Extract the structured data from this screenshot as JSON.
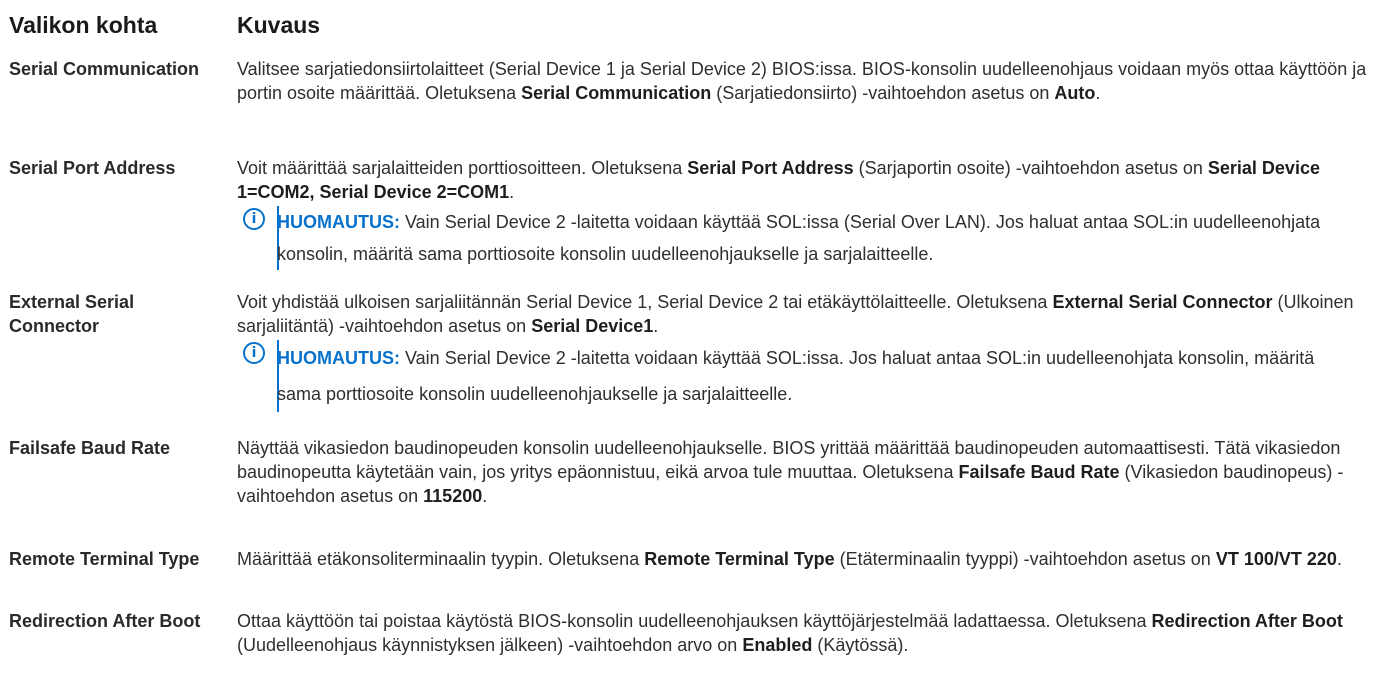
{
  "header": {
    "col1": "Valikon kohta",
    "col2": "Kuvaus"
  },
  "rows": [
    {
      "term": "Serial Communication",
      "desc": [
        "Valitsee sarjatiedonsiirtolaitteet (Serial Device 1 ja Serial Device 2) BIOS:issa. BIOS-konsolin uudelleenohjaus voidaan myös ottaa käyttöön ja portin osoite määrittää. Oletuksena ",
        "Serial Communication",
        " (Sarjatiedonsiirto) -vaihtoehdon asetus on ",
        "Auto",
        "."
      ]
    },
    {
      "term": "Serial Port Address",
      "desc": [
        "Voit määrittää sarjalaitteiden porttiosoitteen. Oletuksena ",
        "Serial Port Address",
        " (Sarjaportin osoite) -vaihtoehdon asetus on ",
        "Serial Device 1=COM2, Serial Device 2=COM1",
        "."
      ],
      "note": {
        "label": "HUOMAUTUS:",
        "text": " Vain Serial Device 2 -laitetta voidaan käyttää SOL:issa (Serial Over LAN). Jos haluat antaa SOL:in uudelleenohjata konsolin, määritä sama porttiosoite konsolin uudelleenohjaukselle ja sarjalaitteelle."
      }
    },
    {
      "term": "External Serial Connector",
      "desc": [
        "Voit yhdistää ulkoisen sarjaliitännän Serial Device 1, Serial Device 2 tai etäkäyttölaitteelle. Oletuksena ",
        "External Serial Connector",
        " (Ulkoinen sarjaliitäntä) -vaihtoehdon asetus on ",
        "Serial Device1",
        "."
      ],
      "note": {
        "label": "HUOMAUTUS:",
        "text": " Vain Serial Device 2 -laitetta voidaan käyttää SOL:issa. Jos haluat antaa SOL:in uudelleenohjata konsolin, määritä sama porttiosoite konsolin uudelleenohjaukselle ja sarjalaitteelle."
      }
    },
    {
      "term": "Failsafe Baud Rate",
      "desc": [
        "Näyttää vikasiedon baudinopeuden konsolin uudelleenohjaukselle. BIOS yrittää määrittää baudinopeuden automaattisesti. Tätä vikasiedon baudinopeutta käytetään vain, jos yritys epäonnistuu, eikä arvoa tule muuttaa. Oletuksena ",
        "Failsafe Baud Rate",
        " (Vikasiedon baudinopeus) -vaihtoehdon asetus on ",
        "115200",
        "."
      ]
    },
    {
      "term": "Remote Terminal Type",
      "desc": [
        "Määrittää etäkonsoliterminaalin tyypin. Oletuksena ",
        "Remote Terminal Type",
        " (Etäterminaalin tyyppi) -vaihtoehdon asetus on ",
        "VT 100/VT 220",
        "."
      ]
    },
    {
      "term": "Redirection After Boot",
      "desc": [
        "Ottaa käyttöön tai poistaa käytöstä BIOS-konsolin uudelleenohjauksen käyttöjärjestelmää ladattaessa. Oletuksena ",
        "Redirection After Boot",
        " (Uudelleenohjaus käynnistyksen jälkeen) -vaihtoehdon arvo on ",
        "Enabled",
        " (Käytössä)."
      ]
    }
  ],
  "icons": {
    "note": "info-icon"
  },
  "colors": {
    "accent": "#0672cb",
    "text": "#2f2f2f"
  }
}
